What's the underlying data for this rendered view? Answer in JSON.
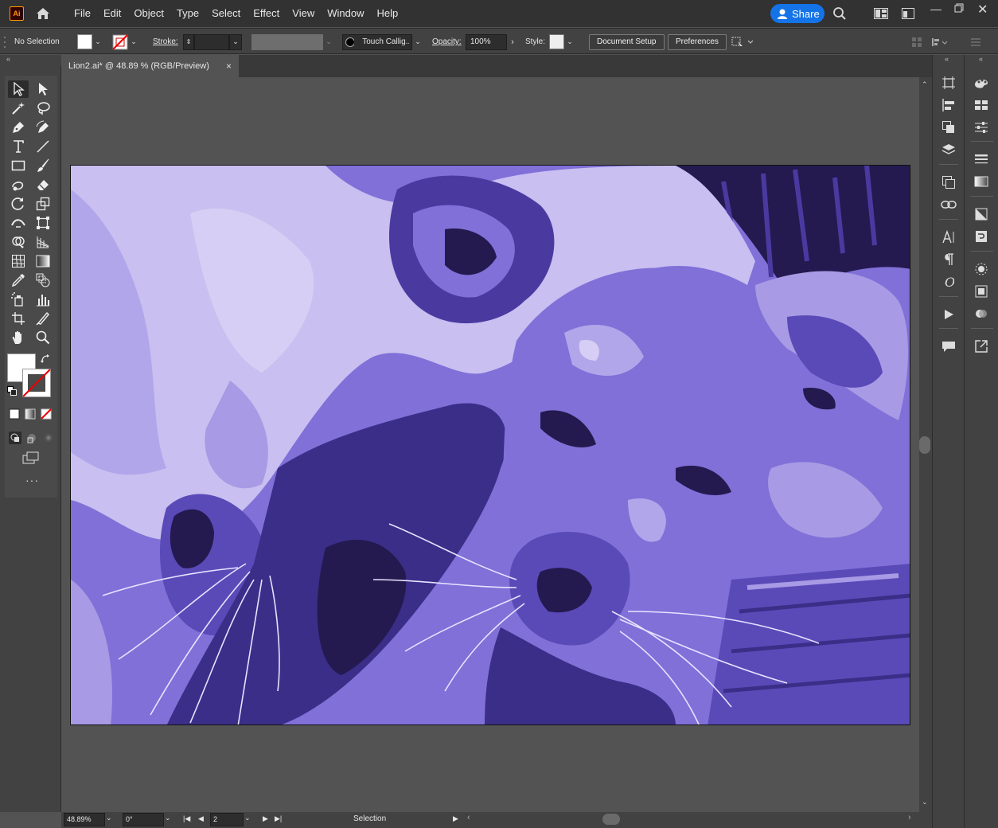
{
  "app": {
    "logo": "Ai",
    "accent": "#1473e6",
    "logo_color": "#ff9a00"
  },
  "menu": [
    "File",
    "Edit",
    "Object",
    "Type",
    "Select",
    "Effect",
    "View",
    "Window",
    "Help"
  ],
  "share": {
    "label": "Share"
  },
  "control_bar": {
    "selection_status": "No Selection",
    "stroke_label": "Stroke:",
    "brush_name": "Touch Callig...",
    "opacity_label": "Opacity:",
    "opacity_value": "100%",
    "style_label": "Style:",
    "document_setup": "Document Setup",
    "preferences": "Preferences"
  },
  "document": {
    "tab_title": "Lion2.ai* @ 48.89 % (RGB/Preview)",
    "close": "×"
  },
  "status": {
    "zoom": "48.89%",
    "rotation": "0°",
    "artboard": "2",
    "tool": "Selection"
  },
  "colors": {
    "artwork_light": "#c9bff0",
    "artwork_mid": "#8070d8",
    "artwork_dark": "#4a3aa0",
    "artwork_darkest": "#221848"
  }
}
